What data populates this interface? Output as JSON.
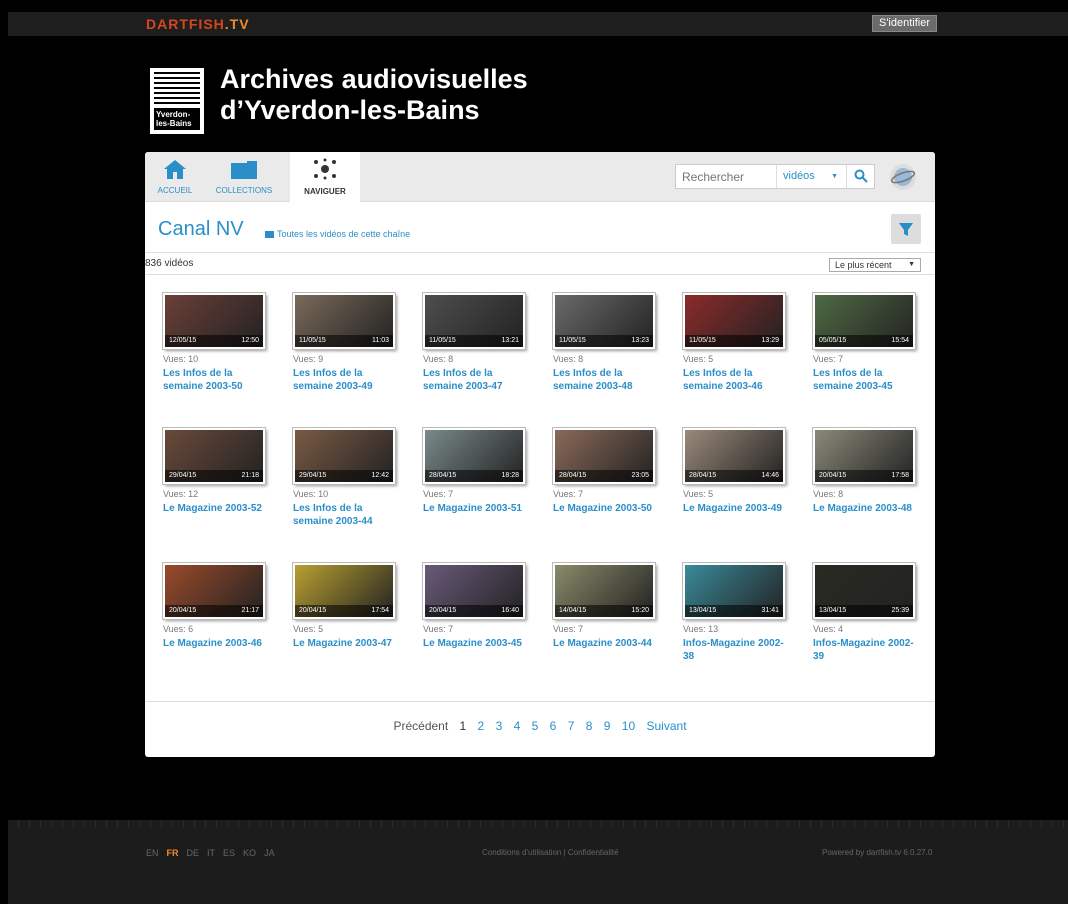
{
  "topbar": {
    "brand_main": "DARTFISH",
    "brand_tv": ".TV",
    "signin_label": "S'identifier"
  },
  "header": {
    "crest_text": "Yverdon-\nles-Bains",
    "title_line1": "Archives audiovisuelles",
    "title_line2": "d’Yverdon-les-Bains"
  },
  "nav": {
    "tabs": [
      {
        "label": "ACCUEIL",
        "icon": "home-icon",
        "color": "#2a8fc9"
      },
      {
        "label": "COLLECTIONS",
        "icon": "folder-icon",
        "color": "#2a8fc9"
      },
      {
        "label": "NAVIGUER",
        "icon": "network-icon",
        "color": "#333333"
      }
    ],
    "search_placeholder": "Rechercher",
    "search_scope": "vidéos"
  },
  "channel": {
    "title": "Canal NV",
    "all_videos_link": "Toutes les vidéos de cette chaîne",
    "count": "836 vidéos",
    "sort": "Le plus récent"
  },
  "videos": [
    {
      "date": "12/05/15",
      "duration": "12:50",
      "views": "Vues: 10",
      "title": "Les Infos de la semaine 2003-50",
      "tint": "#6b3f38"
    },
    {
      "date": "11/05/15",
      "duration": "11:03",
      "views": "Vues: 9",
      "title": "Les Infos de la semaine 2003-49",
      "tint": "#7a6a5a"
    },
    {
      "date": "11/05/15",
      "duration": "13:21",
      "views": "Vues: 8",
      "title": "Les Infos de la semaine 2003-47",
      "tint": "#4e4e4e"
    },
    {
      "date": "11/05/15",
      "duration": "13:23",
      "views": "Vues: 8",
      "title": "Les Infos de la semaine 2003-48",
      "tint": "#6a6a6a"
    },
    {
      "date": "11/05/15",
      "duration": "13:29",
      "views": "Vues: 5",
      "title": "Les Infos de la semaine 2003-46",
      "tint": "#8c2a2a"
    },
    {
      "date": "05/05/15",
      "duration": "15:54",
      "views": "Vues: 7",
      "title": "Les Infos de la semaine 2003-45",
      "tint": "#4f6a44"
    },
    {
      "date": "29/04/15",
      "duration": "21:18",
      "views": "Vues: 12",
      "title": "Le Magazine 2003-52",
      "tint": "#6a4a3a"
    },
    {
      "date": "29/04/15",
      "duration": "12:42",
      "views": "Vues: 10",
      "title": "Les Infos de la semaine 2003-44",
      "tint": "#7a5a44"
    },
    {
      "date": "28/04/15",
      "duration": "18:28",
      "views": "Vues: 7",
      "title": "Le Magazine 2003-51",
      "tint": "#7a8a8a"
    },
    {
      "date": "28/04/15",
      "duration": "23:05",
      "views": "Vues: 7",
      "title": "Le Magazine 2003-50",
      "tint": "#8a6a5a"
    },
    {
      "date": "28/04/15",
      "duration": "14:46",
      "views": "Vues: 5",
      "title": "Le Magazine 2003-49",
      "tint": "#9a8a7a"
    },
    {
      "date": "20/04/15",
      "duration": "17:58",
      "views": "Vues: 8",
      "title": "Le Magazine 2003-48",
      "tint": "#8a8a7a"
    },
    {
      "date": "20/04/15",
      "duration": "21:17",
      "views": "Vues: 6",
      "title": "Le Magazine 2003-46",
      "tint": "#9a4a2a"
    },
    {
      "date": "20/04/15",
      "duration": "17:54",
      "views": "Vues: 5",
      "title": "Le Magazine 2003-47",
      "tint": "#b8a030"
    },
    {
      "date": "20/04/15",
      "duration": "16:40",
      "views": "Vues: 7",
      "title": "Le Magazine 2003-45",
      "tint": "#6a5a7a"
    },
    {
      "date": "14/04/15",
      "duration": "15:20",
      "views": "Vues: 7",
      "title": "Le Magazine 2003-44",
      "tint": "#8a8a6a"
    },
    {
      "date": "13/04/15",
      "duration": "31:41",
      "views": "Vues: 13",
      "title": "Infos-Magazine 2002-38",
      "tint": "#3a8a9a"
    },
    {
      "date": "13/04/15",
      "duration": "25:39",
      "views": "Vues: 4",
      "title": "Infos-Magazine 2002-39",
      "tint": "#2a2a22"
    }
  ],
  "pager": {
    "prev": "Précédent",
    "current": "1",
    "pages": [
      "2",
      "3",
      "4",
      "5",
      "6",
      "7",
      "8",
      "9",
      "10"
    ],
    "next": "Suivant"
  },
  "footer": {
    "languages": [
      {
        "code": "EN",
        "active": false
      },
      {
        "code": "FR",
        "active": true
      },
      {
        "code": "DE",
        "active": false
      },
      {
        "code": "IT",
        "active": false
      },
      {
        "code": "ES",
        "active": false
      },
      {
        "code": "KO",
        "active": false
      },
      {
        "code": "JA",
        "active": false
      }
    ],
    "legal": "Conditions d'utilisation | Confidentialité",
    "powered": "Powered by dartfish.tv 6.0.27.0"
  },
  "colors": {
    "accent": "#2a8fc9",
    "brand_red": "#d6461f",
    "brand_orange": "#f28a2c"
  }
}
